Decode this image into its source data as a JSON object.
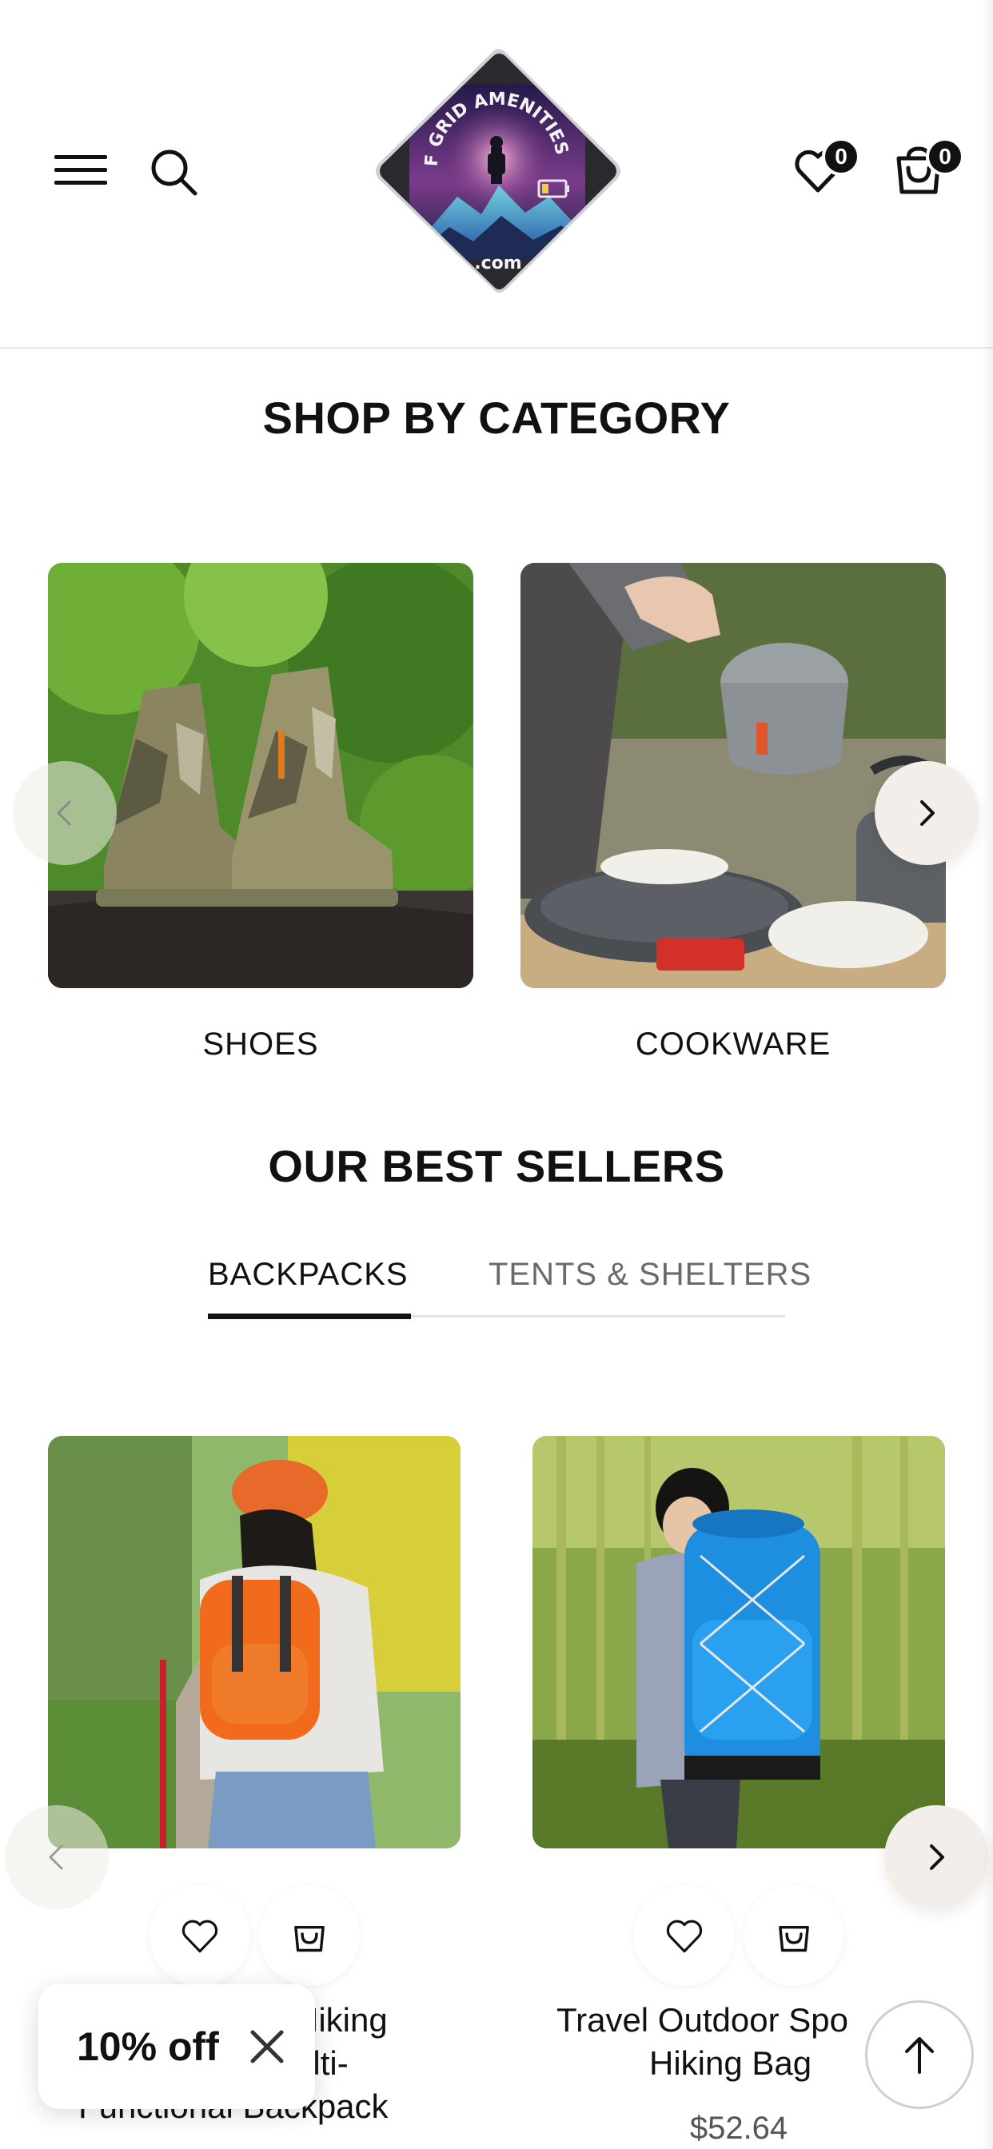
{
  "header": {
    "menu_icon": "hamburger-menu-icon",
    "search_icon": "search-icon",
    "logo": {
      "top_text": "OFF GRID AMENITIES Co.",
      "bottom_text": ".com"
    },
    "wishlist": {
      "icon": "heart-icon",
      "count": "0"
    },
    "cart": {
      "icon": "shopping-bag-icon",
      "count": "0"
    }
  },
  "shop_by_category": {
    "title": "SHOP BY CATEGORY",
    "items": [
      {
        "label": "SHOES"
      },
      {
        "label": "COOKWARE"
      }
    ]
  },
  "best_sellers": {
    "title": "OUR BEST SELLERS",
    "tabs": [
      {
        "label": "BACKPACKS",
        "active": true
      },
      {
        "label": "TENTS & SHELTERS",
        "active": false
      }
    ],
    "products": [
      {
        "title_line1": "Hiking",
        "title_line2": "ulti-",
        "title_line3": "Functional Backpack",
        "backpack_color": "#f26a1b"
      },
      {
        "title_line1": "Travel Outdoor Spo",
        "title_line2": "Hiking Bag",
        "price": "$52.64",
        "backpack_color": "#1e8fe0"
      }
    ]
  },
  "discount_popup": {
    "text": "10% off",
    "close_icon": "close-icon"
  },
  "back_to_top_icon": "arrow-up-icon",
  "colors": {
    "text": "#111111",
    "muted": "#6a6a6a",
    "arrow_bg": "#f4eeea",
    "logo_frame": "#2a2a2e"
  }
}
